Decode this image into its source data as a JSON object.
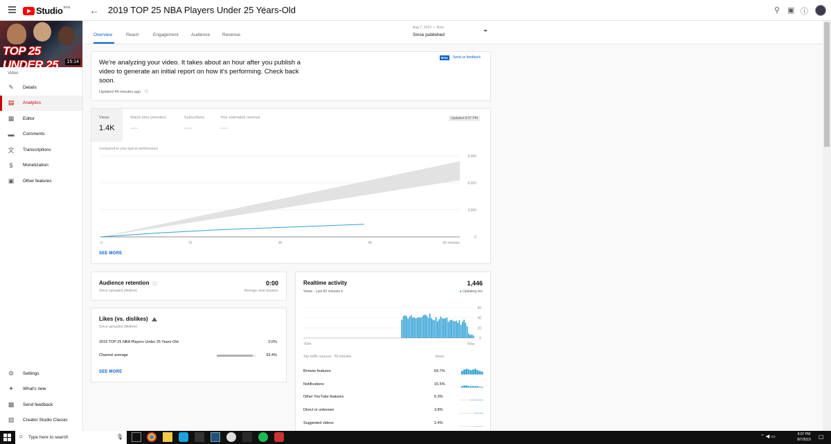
{
  "header": {
    "logo_word": "Studio",
    "logo_beta": "beta",
    "video_title": "2019 TOP 25 NBA Players Under 25 Years-Old"
  },
  "sidebar": {
    "thumbnail_text": "TOP 25 UNDER 25",
    "duration": "15:14",
    "section_label": "Video",
    "items": [
      {
        "label": "Details",
        "icon": "pencil-icon"
      },
      {
        "label": "Analytics",
        "icon": "analytics-icon"
      },
      {
        "label": "Editor",
        "icon": "film-icon"
      },
      {
        "label": "Comments",
        "icon": "comment-icon"
      },
      {
        "label": "Transcriptions",
        "icon": "translate-icon"
      },
      {
        "label": "Monetization",
        "icon": "dollar-icon"
      },
      {
        "label": "Other features",
        "icon": "features-icon"
      }
    ],
    "bottom_items": [
      {
        "label": "Settings",
        "icon": "gear-icon"
      },
      {
        "label": "What's new",
        "icon": "sparkle-icon"
      },
      {
        "label": "Send feedback",
        "icon": "feedback-icon"
      },
      {
        "label": "Creator Studio Classic",
        "icon": "classic-icon"
      }
    ]
  },
  "tabs": [
    "Overview",
    "Reach",
    "Engagement",
    "Audience",
    "Revenue"
  ],
  "date_range": {
    "range": "Aug 7, 2019 — Now",
    "label": "Since published"
  },
  "analyzing_card": {
    "message": "We're analyzing your video. It takes about an hour after you publish a video to generate an initial report on how it's performing. Check back soon.",
    "updated": "Updated 44 minutes ago",
    "beta": "Beta",
    "feedback": "Send us feedback"
  },
  "metrics_card": {
    "metrics": [
      {
        "label": "Views",
        "value": "1.4K"
      },
      {
        "label": "Watch time (minutes)",
        "value": "—"
      },
      {
        "label": "Subscribers",
        "value": "—"
      },
      {
        "label": "Your estimated revenue",
        "value": "—"
      }
    ],
    "updated_chip": "Updated 8:07 PM",
    "compared": "Compared to your typical performance",
    "see_more": "SEE MORE"
  },
  "chart_data": [
    {
      "type": "line",
      "x_tick_labels": [
        "0",
        "15",
        "30",
        "45",
        "60 minutes"
      ],
      "y_tick_labels": [
        "9,000",
        "6,000",
        "3,000",
        "0"
      ],
      "ylim": [
        0,
        9000
      ],
      "xlim": [
        0,
        60
      ],
      "series": [
        {
          "x": [
            0,
            10,
            20,
            30,
            40,
            44
          ],
          "values": [
            0,
            450,
            800,
            1050,
            1300,
            1400
          ]
        }
      ],
      "typical_band": {
        "x": [
          0,
          60
        ],
        "low": [
          0,
          6300
        ],
        "high": [
          0,
          8400
        ]
      }
    },
    {
      "type": "bar",
      "y_tick_labels": [
        "60",
        "40",
        "20",
        "0"
      ],
      "x_tick_labels": [
        "-60m",
        "Now"
      ],
      "ylim": [
        0,
        60
      ],
      "values": [
        0,
        0,
        0,
        0,
        0,
        0,
        0,
        0,
        0,
        0,
        0,
        0,
        0,
        0,
        0,
        0,
        0,
        0,
        0,
        0,
        0,
        0,
        0,
        0,
        0,
        0,
        0,
        0,
        0,
        0,
        0,
        0,
        0,
        0,
        0,
        0,
        0,
        0,
        0,
        0,
        0,
        0,
        0,
        0,
        0,
        0,
        0,
        0,
        0,
        0,
        0,
        0,
        0,
        0,
        0,
        0,
        0,
        0,
        0,
        0,
        0,
        0,
        0,
        36,
        43,
        45,
        43,
        38,
        42,
        45,
        40,
        41,
        39,
        40,
        41,
        40,
        42,
        45,
        46,
        44,
        40,
        48,
        39,
        36,
        35,
        41,
        33,
        37,
        42,
        39,
        38,
        39,
        40,
        32,
        35,
        36,
        34,
        33,
        34,
        30,
        35,
        26,
        32,
        36,
        30,
        23,
        9,
        6,
        7,
        5
      ]
    }
  ],
  "retention_card": {
    "title": "Audience retention",
    "sub": "Since uploaded (lifetime)",
    "value": "0:00",
    "value_label": "Average view duration"
  },
  "likes_card": {
    "title": "Likes (vs. dislikes)",
    "sub": "Since uploaded (lifetime)",
    "rows": [
      {
        "label": "2019 TOP 25 NBA Players Under 25 Years-Old",
        "value": "0.0%",
        "fill": 0
      },
      {
        "label": "Channel average",
        "value": "93.4%",
        "fill": 0.934
      }
    ],
    "see_more": "SEE MORE"
  },
  "realtime_card": {
    "title": "Realtime activity",
    "count": "1,446",
    "sub": "Views · Last 60 minutes",
    "live": "Updating live",
    "sources_header": "Top traffic sources · 60 minutes",
    "views_header": "Views",
    "sources": [
      {
        "label": "Browse features",
        "value": "69.7%"
      },
      {
        "label": "Notifications",
        "value": "15.5%"
      },
      {
        "label": "Other YouTube features",
        "value": "6.3%"
      },
      {
        "label": "Direct or unknown",
        "value": "3.8%"
      },
      {
        "label": "Suggested videos",
        "value": "2.4%"
      }
    ]
  },
  "taskbar": {
    "search_placeholder": "Type here to search",
    "time": "8:07 PM",
    "date": "8/7/2019"
  },
  "colors": {
    "accent": "#065fd4",
    "brand": "#ff0000",
    "bar": "#2d9fd6",
    "active_nav": "#cc0000"
  }
}
